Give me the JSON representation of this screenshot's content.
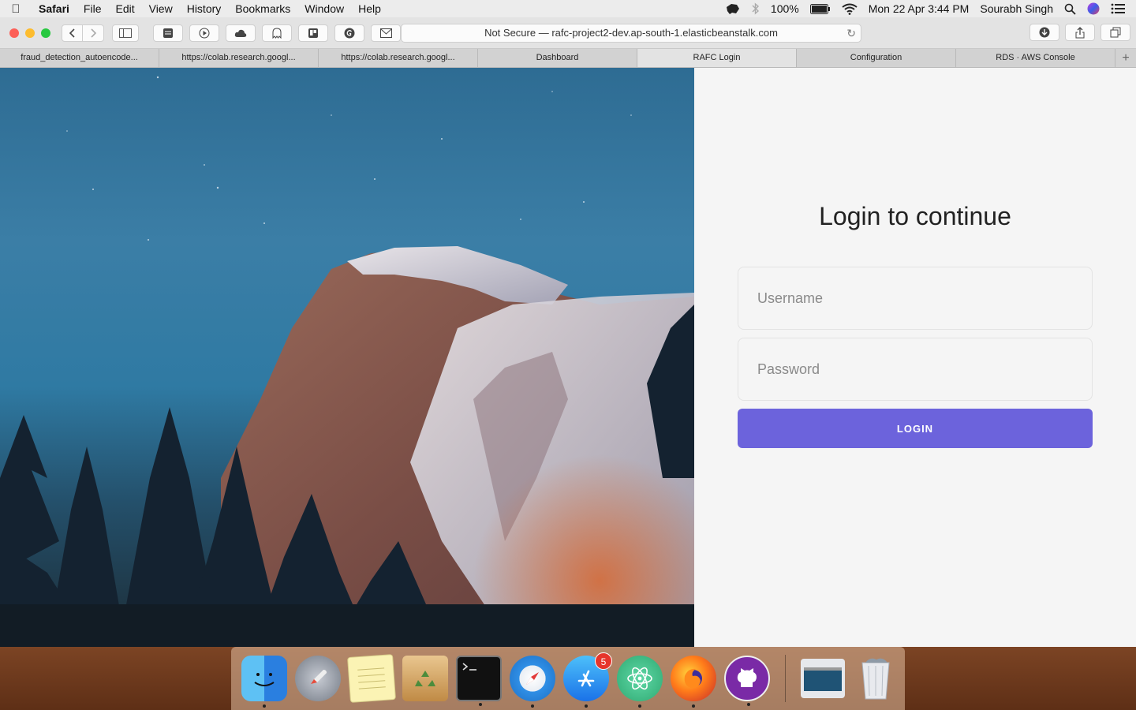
{
  "menubar": {
    "app_name": "Safari",
    "menus": [
      "File",
      "Edit",
      "View",
      "History",
      "Bookmarks",
      "Window",
      "Help"
    ],
    "battery": "100%",
    "datetime": "Mon 22 Apr  3:44 PM",
    "user": "Sourabh Singh"
  },
  "browser": {
    "url": "Not Secure — rafc-project2-dev.ap-south-1.elasticbeanstalk.com",
    "tabs": [
      {
        "label": "fraud_detection_autoencode...",
        "active": false
      },
      {
        "label": "https://colab.research.googl...",
        "active": false
      },
      {
        "label": "https://colab.research.googl...",
        "active": false
      },
      {
        "label": "Dashboard",
        "active": false
      },
      {
        "label": "RAFC Login",
        "active": true
      },
      {
        "label": "Configuration",
        "active": false
      },
      {
        "label": "RDS · AWS Console",
        "active": false
      }
    ],
    "new_tab_symbol": "+"
  },
  "login": {
    "title": "Login to continue",
    "username_placeholder": "Username",
    "password_placeholder": "Password",
    "button_label": "LOGIN",
    "button_color": "#6c63dc"
  },
  "dock": {
    "apps": [
      {
        "name": "finder-icon",
        "running": true
      },
      {
        "name": "launchpad-icon",
        "running": false
      },
      {
        "name": "notes-icon",
        "running": false
      },
      {
        "name": "archive-utility-icon",
        "running": false
      },
      {
        "name": "terminal-icon",
        "running": true
      },
      {
        "name": "safari-icon",
        "running": true
      },
      {
        "name": "app-store-icon",
        "running": true,
        "badge": "5"
      },
      {
        "name": "atom-icon",
        "running": true
      },
      {
        "name": "firefox-icon",
        "running": true
      },
      {
        "name": "github-desktop-icon",
        "running": true
      }
    ]
  }
}
